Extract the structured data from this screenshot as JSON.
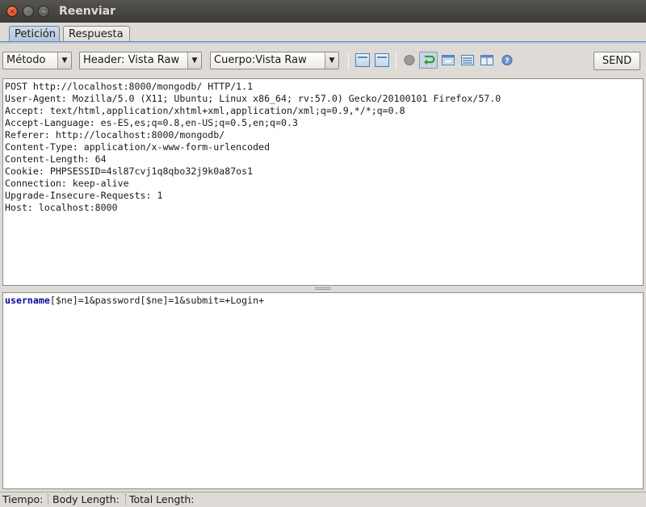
{
  "window": {
    "title": "Reenviar",
    "close_glyph": "×",
    "min_glyph": "–",
    "max_glyph": "□"
  },
  "tabs": [
    {
      "label": "Petición",
      "active": true
    },
    {
      "label": "Respuesta",
      "active": false
    }
  ],
  "toolbar": {
    "method_combo": "Método",
    "header_combo": "Header: Vista Raw",
    "body_combo": "Cuerpo:Vista Raw",
    "dropdown_glyph": "▼",
    "send_label": "SEND",
    "icons": [
      "panel-top-icon",
      "panel-bottom-icon",
      "record-icon",
      "wrap-icon",
      "window-icon",
      "list-icon",
      "columns-icon",
      "help-icon"
    ]
  },
  "request": {
    "header_lines": [
      "POST http://localhost:8000/mongodb/ HTTP/1.1",
      "User-Agent: Mozilla/5.0 (X11; Ubuntu; Linux x86_64; rv:57.0) Gecko/20100101 Firefox/57.0",
      "Accept: text/html,application/xhtml+xml,application/xml;q=0.9,*/*;q=0.8",
      "Accept-Language: es-ES,es;q=0.8,en-US;q=0.5,en;q=0.3",
      "Referer: http://localhost:8000/mongodb/",
      "Content-Type: application/x-www-form-urlencoded",
      "Content-Length: 64",
      "Cookie: PHPSESSID=4sl87cvj1q8qbo32j9k0a87os1",
      "Connection: keep-alive",
      "Upgrade-Insecure-Requests: 1",
      "Host: localhost:8000"
    ],
    "body_key": "username",
    "body_rest": "[$ne]=1&password[$ne]=1&submit=+Login+"
  },
  "status": {
    "time_label": "Tiempo:",
    "body_length_label": "Body Length:",
    "total_length_label": "Total Length:"
  },
  "colors": {
    "accent": "#6a86a6",
    "keyword": "#0a0a9a",
    "titlebar": "#3c3b37"
  }
}
